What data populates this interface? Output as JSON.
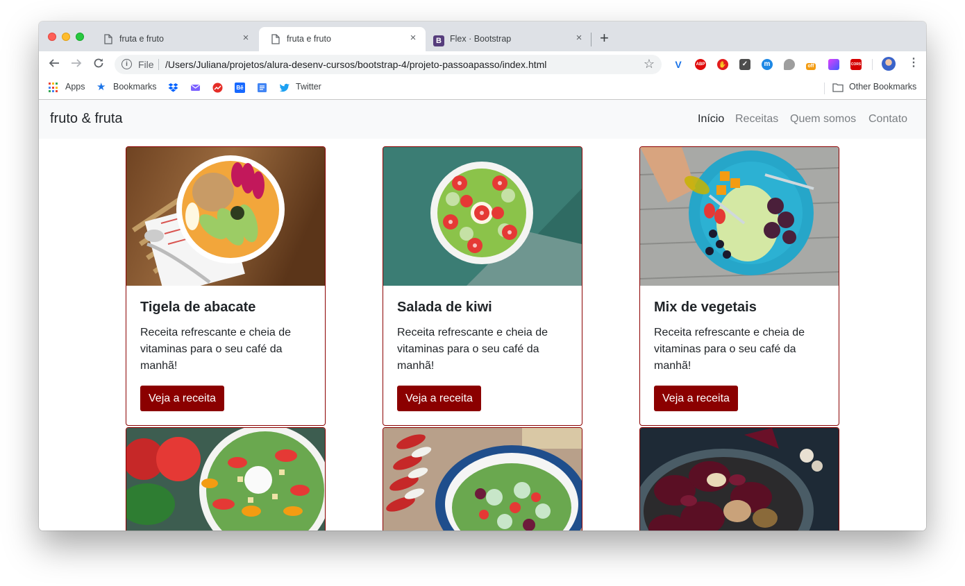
{
  "browser": {
    "tabs": [
      {
        "title": "fruta e fruto",
        "close": "×"
      },
      {
        "title": "fruta e fruto",
        "close": "×"
      },
      {
        "title": "Flex · Bootstrap",
        "favicon_text": "B",
        "close": "×"
      }
    ],
    "new_tab": "+",
    "omnibox": {
      "scheme_label": "File",
      "url": "/Users/Juliana/projetos/alura-desenv-cursos/bootstrap-4/projeto-passoapasso/index.html"
    },
    "extensions": [
      {
        "name": "vivaldi-icon",
        "text": "V",
        "color": "#1a73e8"
      },
      {
        "name": "adblock-plus-icon",
        "text": "ABP",
        "color": "#e00b0b"
      },
      {
        "name": "adblock-hand-icon",
        "text": "✋",
        "color": "#e21d1d"
      },
      {
        "name": "pocket-icon",
        "text": "✓",
        "color": "#4d4d4d"
      },
      {
        "name": "m-extension-icon",
        "text": "m",
        "color": "#1e88e5"
      },
      {
        "name": "chat-bubble-icon",
        "text": "",
        "color": "#9e9e9e"
      },
      {
        "name": "off-extension-icon",
        "text": "off",
        "color": "#f39c12"
      },
      {
        "name": "gradient-extension-icon",
        "text": "",
        "color": "#8e44ad"
      },
      {
        "name": "cors-icon",
        "text": "CORS",
        "color": "#d50000"
      }
    ],
    "bookmarks": {
      "apps": "Apps",
      "bookmarks": "Bookmarks",
      "twitter": "Twitter",
      "other": "Other Bookmarks"
    }
  },
  "site": {
    "brand": "fruto & fruta",
    "nav": [
      {
        "label": "Início",
        "active": true
      },
      {
        "label": "Receitas",
        "active": false
      },
      {
        "label": "Quem somos",
        "active": false
      },
      {
        "label": "Contato",
        "active": false
      }
    ],
    "cards": [
      {
        "title": "Tigela de abacate",
        "text": "Receita refrescante e cheia de vitaminas para o seu café da manhã!",
        "button": "Veja a receita"
      },
      {
        "title": "Salada de kiwi",
        "text": "Receita refrescante e cheia de vitaminas para o seu café da manhã!",
        "button": "Veja a receita"
      },
      {
        "title": "Mix de vegetais",
        "text": "Receita refrescante e cheia de vitaminas para o seu café da manhã!",
        "button": "Veja a receita"
      }
    ]
  },
  "colors": {
    "accent": "#8b0000",
    "navbar_bg": "#f8f9fa",
    "tabstrip_bg": "#dee1e6"
  }
}
